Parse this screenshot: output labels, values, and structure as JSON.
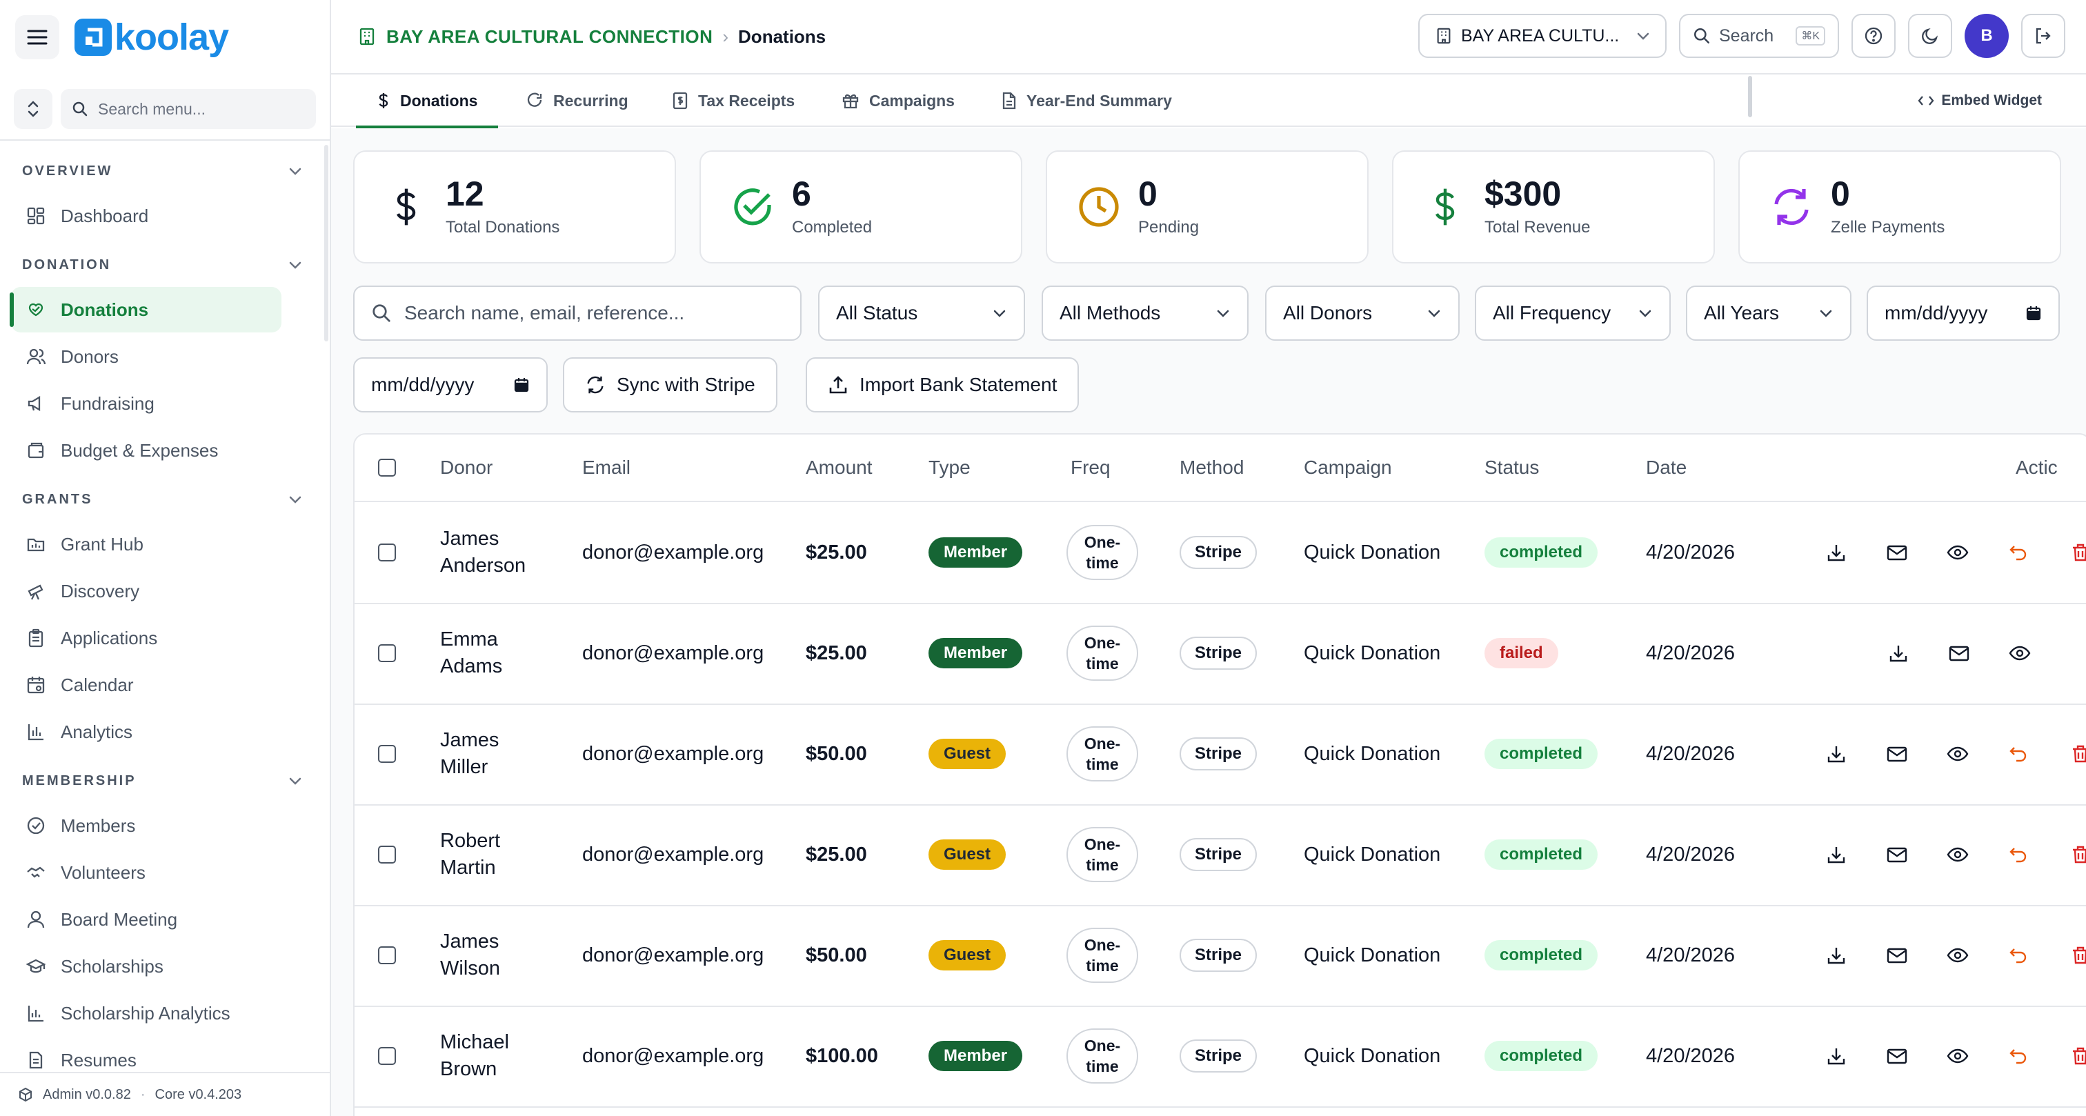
{
  "app": {
    "logo_text": "koolay"
  },
  "sidebar": {
    "search_placeholder": "Search menu...",
    "sections": [
      {
        "title": "OVERVIEW",
        "items": [
          {
            "label": "Dashboard",
            "icon": "dashboard-icon"
          }
        ]
      },
      {
        "title": "DONATION",
        "items": [
          {
            "label": "Donations",
            "icon": "heart-hand-icon",
            "active": true
          },
          {
            "label": "Donors",
            "icon": "users-icon"
          },
          {
            "label": "Fundraising",
            "icon": "megaphone-icon"
          },
          {
            "label": "Budget & Expenses",
            "icon": "wallet-icon"
          }
        ]
      },
      {
        "title": "GRANTS",
        "items": [
          {
            "label": "Grant Hub",
            "icon": "folder-icon"
          },
          {
            "label": "Discovery",
            "icon": "telescope-icon"
          },
          {
            "label": "Applications",
            "icon": "clipboard-icon"
          },
          {
            "label": "Calendar",
            "icon": "calendar-icon"
          },
          {
            "label": "Analytics",
            "icon": "bar-chart-icon"
          }
        ]
      },
      {
        "title": "MEMBERSHIP",
        "items": [
          {
            "label": "Members",
            "icon": "check-badge-icon"
          },
          {
            "label": "Volunteers",
            "icon": "handshake-icon"
          },
          {
            "label": "Board Meeting",
            "icon": "user-icon"
          },
          {
            "label": "Scholarships",
            "icon": "graduation-cap-icon"
          },
          {
            "label": "Scholarship Analytics",
            "icon": "line-chart-icon"
          },
          {
            "label": "Resumes",
            "icon": "document-icon"
          }
        ]
      }
    ],
    "footer": {
      "admin_version": "Admin v0.0.82",
      "core_version": "Core v0.4.203"
    }
  },
  "header": {
    "org_name": "BAY AREA CULTURAL CONNECTION",
    "page": "Donations",
    "org_select": "BAY AREA CULTU...",
    "search_label": "Search",
    "search_kbd": "⌘K",
    "avatar_initial": "B"
  },
  "tabs": [
    {
      "label": "Donations",
      "icon": "dollar-icon",
      "active": true
    },
    {
      "label": "Recurring",
      "icon": "refresh-icon"
    },
    {
      "label": "Tax Receipts",
      "icon": "receipt-icon"
    },
    {
      "label": "Campaigns",
      "icon": "gift-icon"
    },
    {
      "label": "Year-End Summary",
      "icon": "file-icon"
    }
  ],
  "embed_widget": "Embed Widget",
  "stats": [
    {
      "value": "12",
      "label": "Total Donations",
      "icon": "dollar-icon",
      "color": "#111827"
    },
    {
      "value": "6",
      "label": "Completed",
      "icon": "check-circle-icon",
      "color": "#16a34a"
    },
    {
      "value": "0",
      "label": "Pending",
      "icon": "clock-icon",
      "color": "#ca8a04"
    },
    {
      "value": "$300",
      "label": "Total Revenue",
      "icon": "dollar-icon",
      "color": "#15803d"
    },
    {
      "value": "0",
      "label": "Zelle Payments",
      "icon": "refresh-icon",
      "color": "#9333ea"
    }
  ],
  "filters": {
    "search_placeholder": "Search name, email, reference...",
    "status": "All Status",
    "methods": "All Methods",
    "donors": "All Donors",
    "frequency": "All Frequency",
    "years": "All Years",
    "date_from": "mm/dd/yyyy",
    "date_to": "mm/dd/yyyy",
    "sync_button": "Sync with Stripe",
    "import_button": "Import Bank Statement"
  },
  "table": {
    "columns": [
      "Donor",
      "Email",
      "Amount",
      "Type",
      "Freq",
      "Method",
      "Campaign",
      "Status",
      "Date",
      "Actic"
    ],
    "rows": [
      {
        "donor_first": "James",
        "donor_last": "Anderson",
        "email": "donor@example.org",
        "amount": "$25.00",
        "type": "Member",
        "freq_1": "One-",
        "freq_2": "time",
        "method": "Stripe",
        "campaign": "Quick Donation",
        "status": "completed",
        "date": "4/20/2026"
      },
      {
        "donor_first": "Emma",
        "donor_last": "Adams",
        "email": "donor@example.org",
        "amount": "$25.00",
        "type": "Member",
        "freq_1": "One-",
        "freq_2": "time",
        "method": "Stripe",
        "campaign": "Quick Donation",
        "status": "failed",
        "date": "4/20/2026"
      },
      {
        "donor_first": "James",
        "donor_last": "Miller",
        "email": "donor@example.org",
        "amount": "$50.00",
        "type": "Guest",
        "freq_1": "One-",
        "freq_2": "time",
        "method": "Stripe",
        "campaign": "Quick Donation",
        "status": "completed",
        "date": "4/20/2026"
      },
      {
        "donor_first": "Robert",
        "donor_last": "Martin",
        "email": "donor@example.org",
        "amount": "$25.00",
        "type": "Guest",
        "freq_1": "One-",
        "freq_2": "time",
        "method": "Stripe",
        "campaign": "Quick Donation",
        "status": "completed",
        "date": "4/20/2026"
      },
      {
        "donor_first": "James",
        "donor_last": "Wilson",
        "email": "donor@example.org",
        "amount": "$50.00",
        "type": "Guest",
        "freq_1": "One-",
        "freq_2": "time",
        "method": "Stripe",
        "campaign": "Quick Donation",
        "status": "completed",
        "date": "4/20/2026"
      },
      {
        "donor_first": "Michael",
        "donor_last": "Brown",
        "email": "donor@example.org",
        "amount": "$100.00",
        "type": "Member",
        "freq_1": "One-",
        "freq_2": "time",
        "method": "Stripe",
        "campaign": "Quick Donation",
        "status": "completed",
        "date": "4/20/2026"
      }
    ]
  }
}
